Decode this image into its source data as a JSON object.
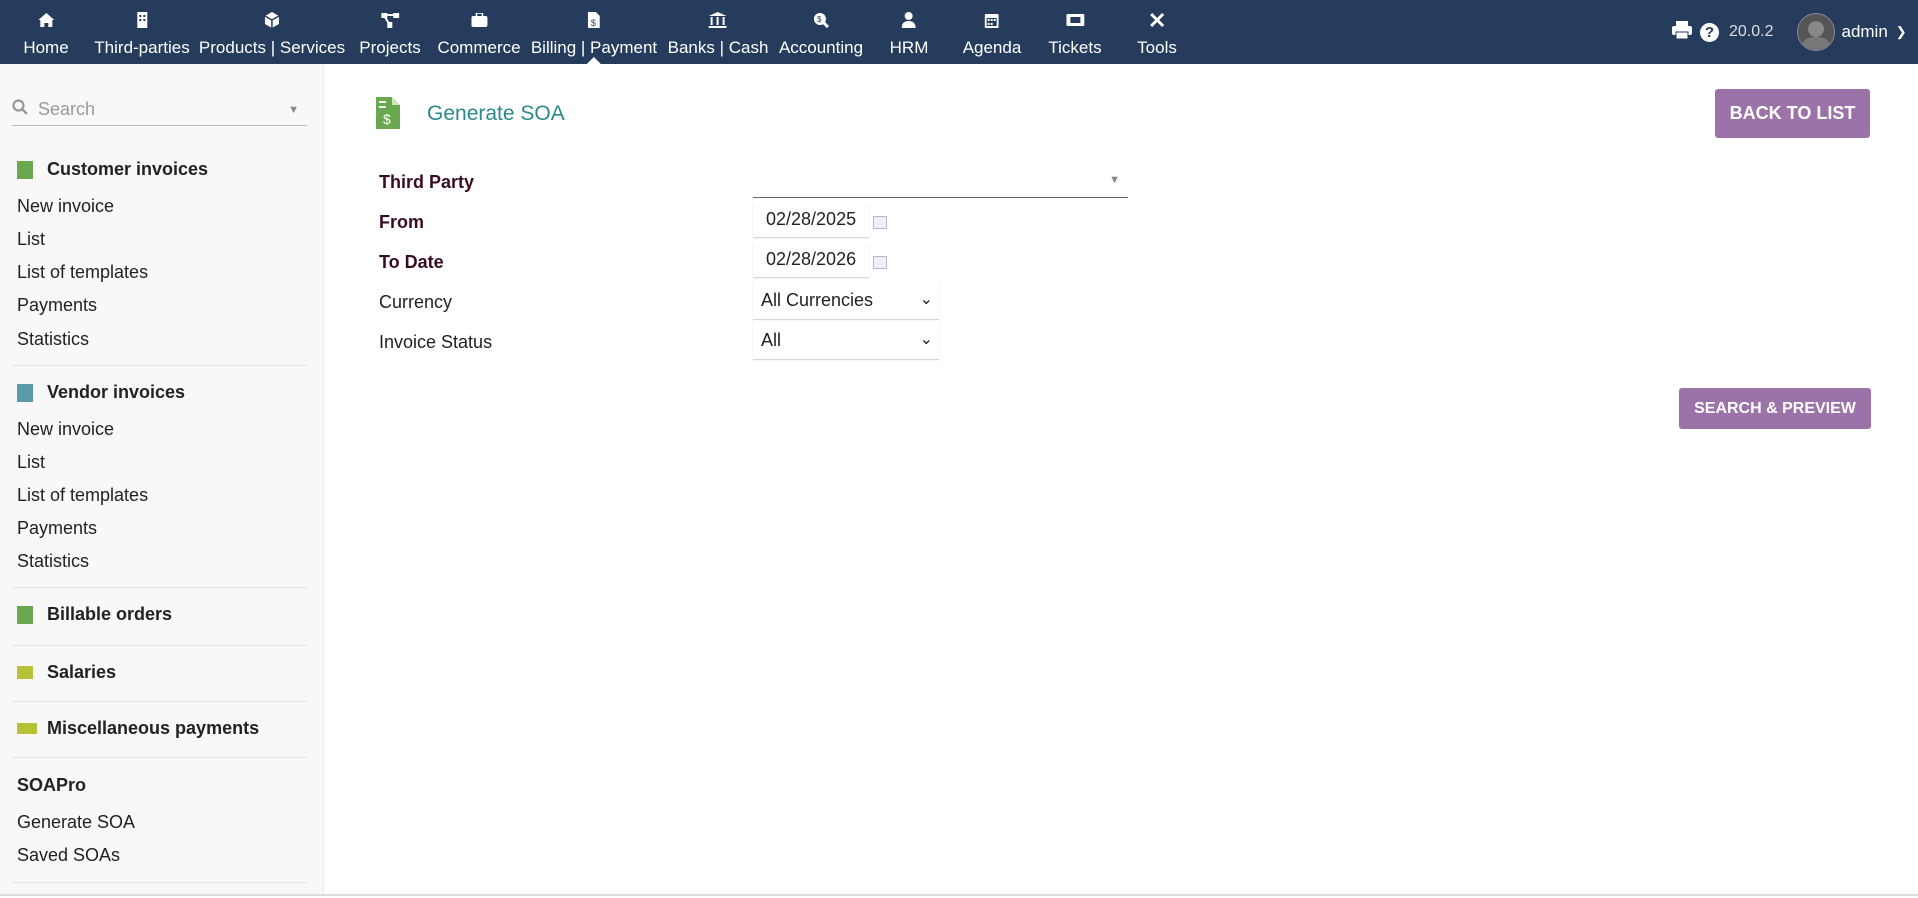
{
  "topnav": {
    "items": [
      {
        "label": "Home",
        "icon": "home-icon"
      },
      {
        "label": "Third-parties",
        "icon": "building-icon"
      },
      {
        "label": "Products | Services",
        "icon": "cube-icon"
      },
      {
        "label": "Projects",
        "icon": "project-icon"
      },
      {
        "label": "Commerce",
        "icon": "suitcase-icon"
      },
      {
        "label": "Billing | Payment",
        "icon": "invoice-dollar-icon",
        "active": true
      },
      {
        "label": "Banks | Cash",
        "icon": "bank-icon"
      },
      {
        "label": "Accounting",
        "icon": "search-dollar-icon"
      },
      {
        "label": "HRM",
        "icon": "user-tie-icon"
      },
      {
        "label": "Agenda",
        "icon": "calendar-icon"
      },
      {
        "label": "Tickets",
        "icon": "ticket-icon"
      },
      {
        "label": "Tools",
        "icon": "tools-icon"
      }
    ],
    "version": "20.0.2",
    "user": "admin"
  },
  "sidebar": {
    "search_placeholder": "Search",
    "sections": [
      {
        "title": "Customer invoices",
        "items": [
          "New invoice",
          "List",
          "List of templates",
          "Payments",
          "Statistics"
        ]
      },
      {
        "title": "Vendor invoices",
        "items": [
          "New invoice",
          "List",
          "List of templates",
          "Payments",
          "Statistics"
        ]
      },
      {
        "title": "Billable orders"
      },
      {
        "title": "Salaries"
      },
      {
        "title": "Miscellaneous payments"
      },
      {
        "title": "SOAPro",
        "items": [
          "Generate SOA",
          "Saved SOAs"
        ]
      }
    ]
  },
  "main": {
    "title": "Generate SOA",
    "back_label": "BACK TO LIST",
    "search_label": "SEARCH & PREVIEW",
    "fields": {
      "third_party": {
        "label": "Third Party",
        "value": ""
      },
      "from": {
        "label": "From",
        "value": "02/28/2025"
      },
      "to": {
        "label": "To Date",
        "value": "02/28/2026"
      },
      "currency": {
        "label": "Currency",
        "value": "All Currencies"
      },
      "status": {
        "label": "Invoice Status",
        "value": "All"
      }
    }
  },
  "colors": {
    "topbar": "#263c5c",
    "accent": "#9c73a8",
    "title": "#2a8a8a"
  }
}
